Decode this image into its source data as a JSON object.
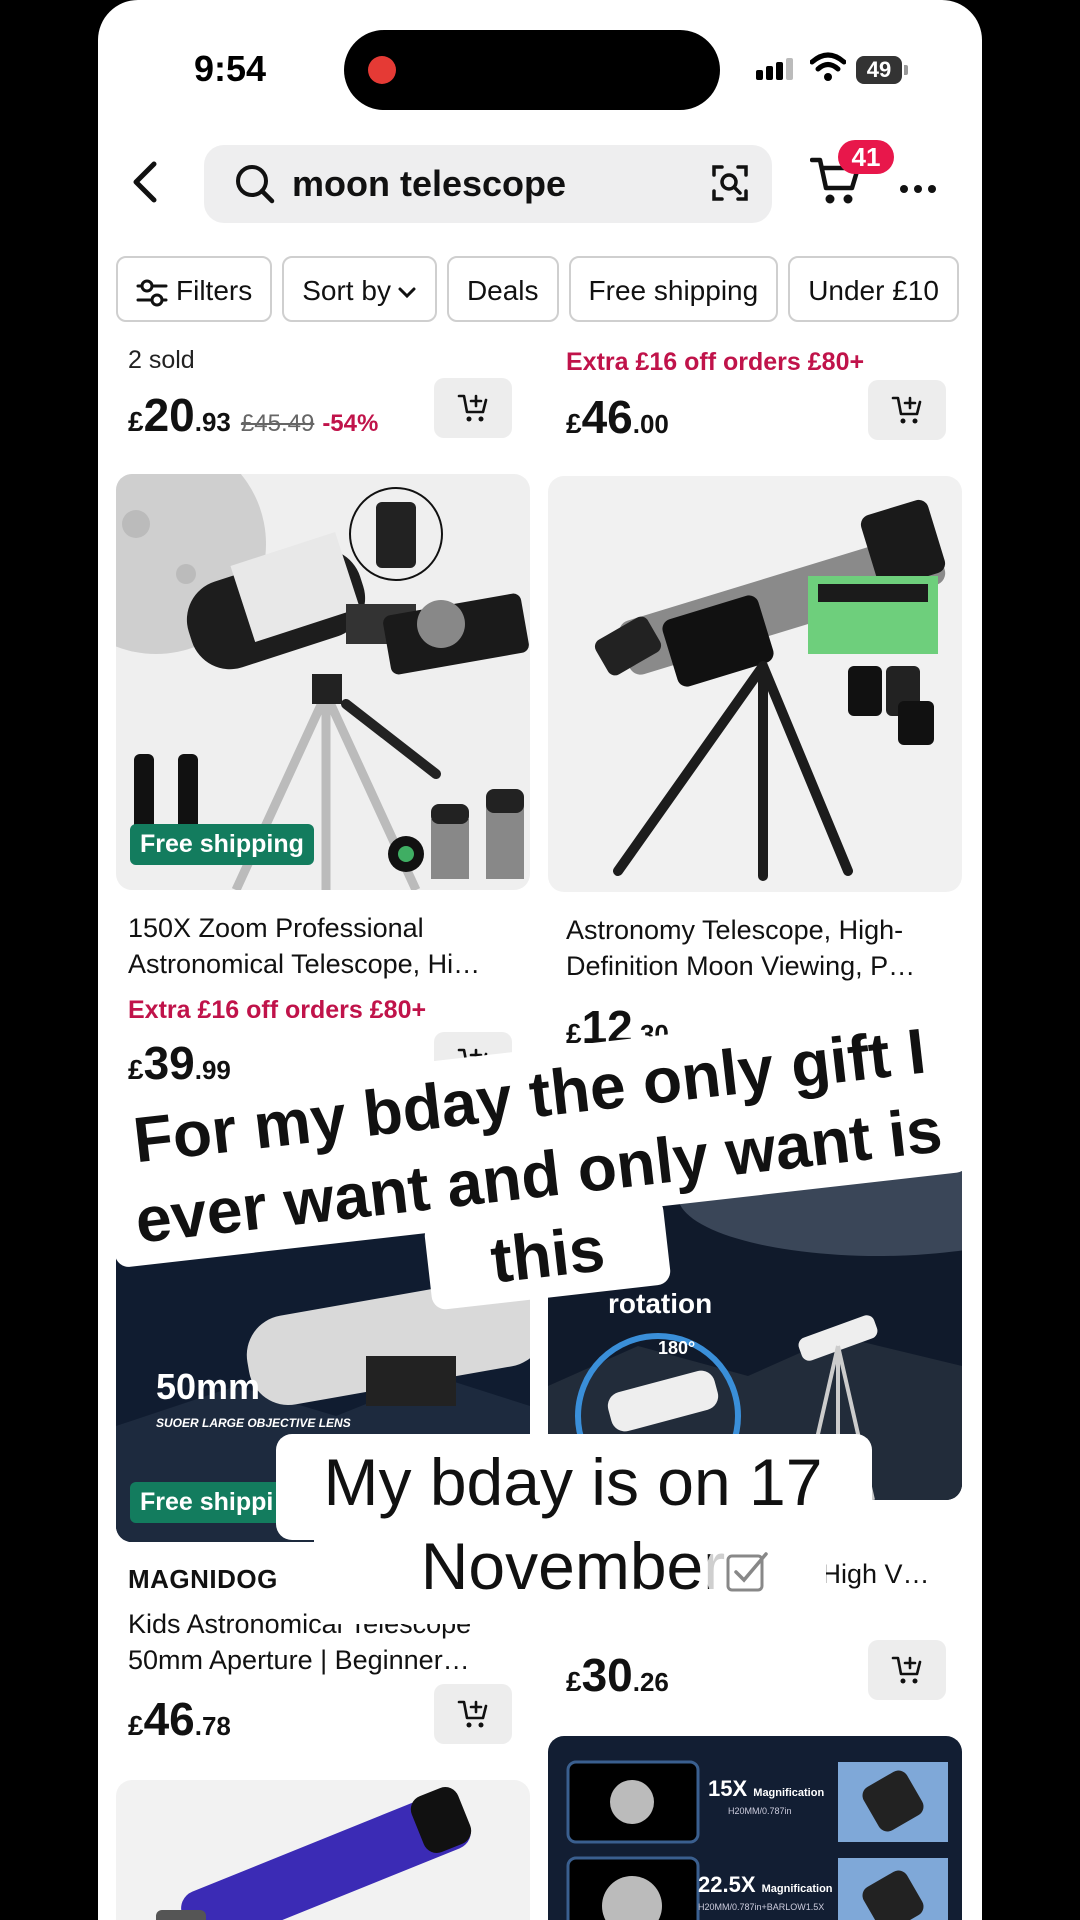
{
  "status_bar": {
    "time": "9:54",
    "battery": "49"
  },
  "search": {
    "query": "moon telescope"
  },
  "cart": {
    "badge_count": "41"
  },
  "filters": {
    "chips": [
      "Filters",
      "Sort by",
      "Deals",
      "Free shipping",
      "Under £10"
    ]
  },
  "products": [
    {
      "sold": "2 sold",
      "price_currency": "£",
      "price_main": "20",
      "price_dec": ".93",
      "old_price": "£45.49",
      "discount": "-54%"
    },
    {
      "promo": "Extra £16 off orders £80+",
      "price_currency": "£",
      "price_main": "46",
      "price_dec": ".00"
    },
    {
      "badge": "Free shipping",
      "title_line1": "150X Zoom Professional",
      "title_line2": "Astronomical Telescope, Hi…",
      "promo": "Extra £16 off orders £80+",
      "price_currency": "£",
      "price_main": "39",
      "price_dec": ".99"
    },
    {
      "title_line1": "Astronomy Telescope, High-",
      "title_line2": "Definition Moon Viewing, P…",
      "price_currency": "£",
      "price_main": "12",
      "price_dec": ".30"
    },
    {
      "image_text": "50mm",
      "image_subtext": "SUOER LARGE OBJECTIVE LENS",
      "badge": "Free shippi",
      "brand": "MAGNIDOG",
      "title_line1": "Kids Astronomical Telescope",
      "title_line2": "50mm Aperture | Beginner…",
      "price_currency": "£",
      "price_main": "46",
      "price_dec": ".78"
    },
    {
      "image_text": "rotation",
      "image_subtext": "180°",
      "title_fragment": "& High V…",
      "price_currency": "£",
      "price_main": "30",
      "price_dec": ".26"
    },
    {
      "magnification_1": "15X",
      "magnification_2": "22.5X",
      "mag_label": "Magnification",
      "spec_1": "H20MM/0.787in",
      "spec_2": "H20MM/0.787in+BARLOW1.5X"
    }
  ],
  "overlay": {
    "caption1_line1": "For my bday the only gift I",
    "caption1_line2": "ever want and only want is",
    "caption1_line3": "this",
    "caption2_line1": "My bday is on 17",
    "caption2_line2": "November"
  },
  "colors": {
    "accent": "#c0134a",
    "badge_red": "#e8174b",
    "free_shipping_green": "#137c5e"
  }
}
